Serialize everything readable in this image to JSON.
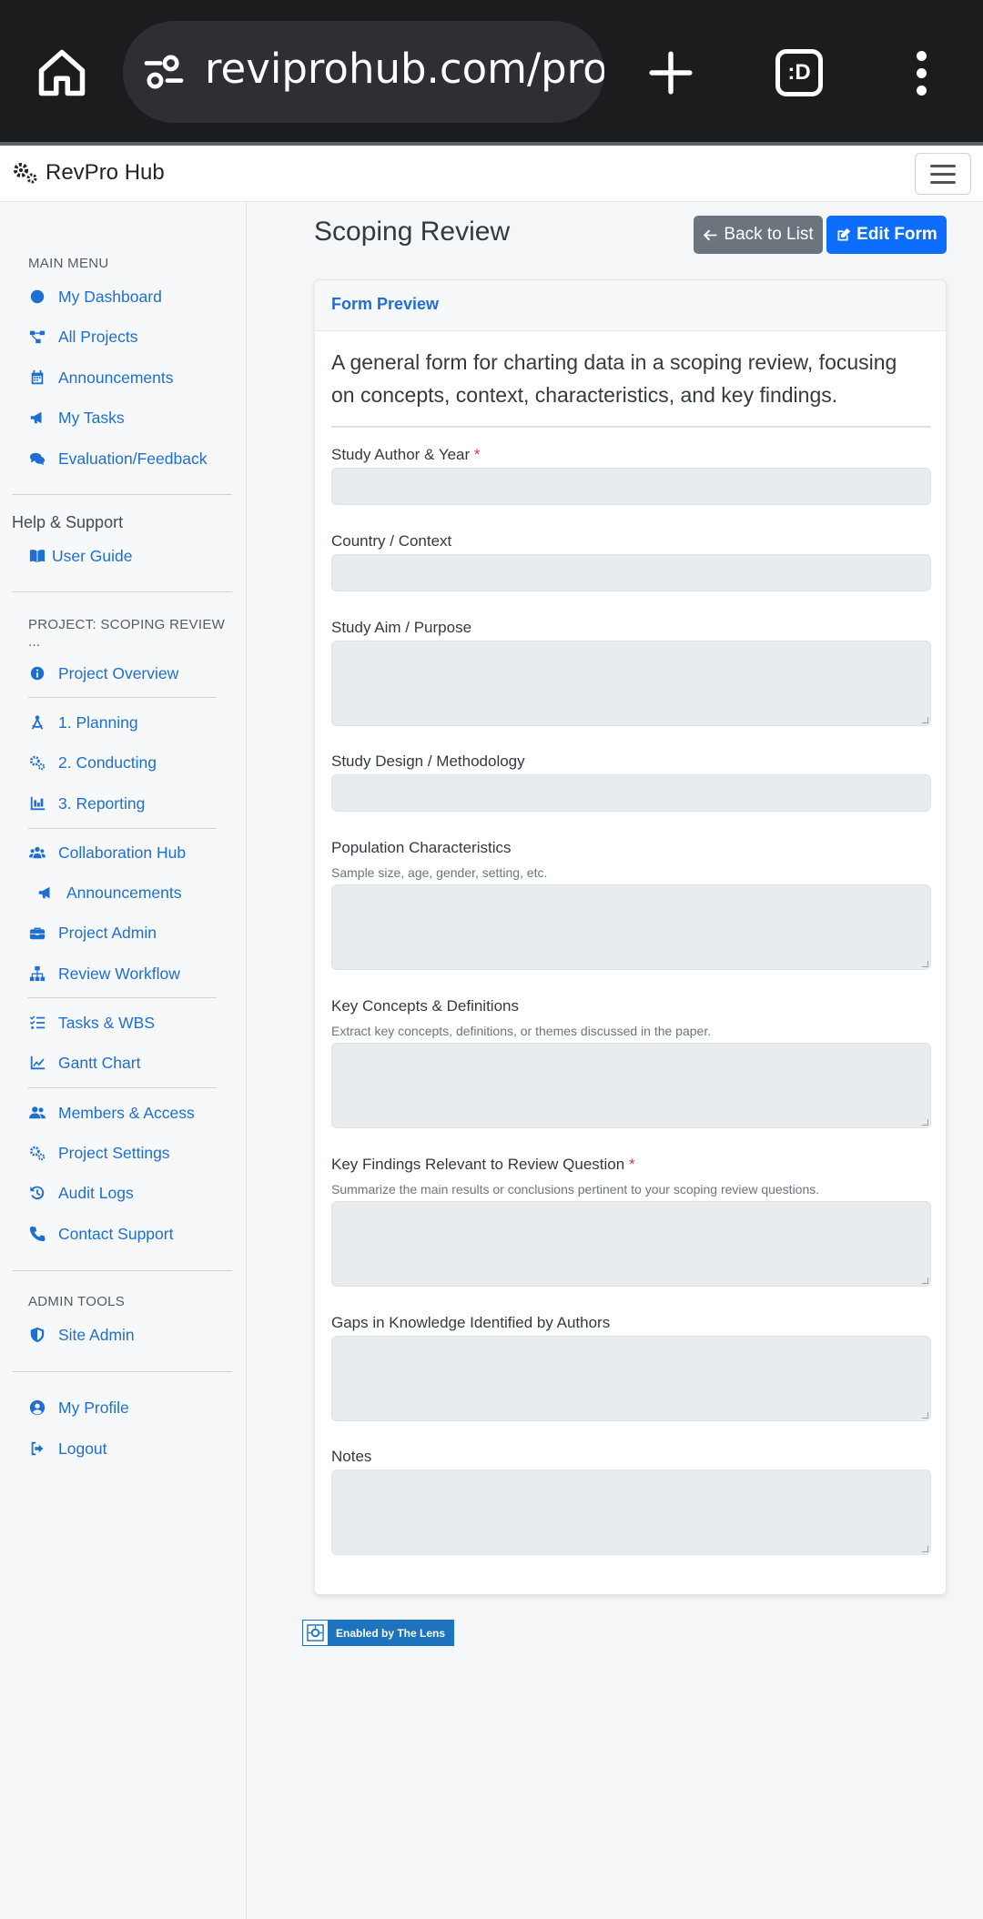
{
  "browser": {
    "url": "reviprohub.com/proje",
    "tabs_icon_label": ":D"
  },
  "navbar": {
    "brand": "RevPro Hub"
  },
  "sidebar": {
    "main_menu_heading": "MAIN MENU",
    "main_items": [
      {
        "label": "My Dashboard",
        "icon": "dashboard-icon"
      },
      {
        "label": "All Projects",
        "icon": "project-diagram-icon"
      },
      {
        "label": "Announcements",
        "icon": "calendar-icon"
      },
      {
        "label": "My Tasks",
        "icon": "megaphone-icon"
      },
      {
        "label": "Evaluation/Feedback",
        "icon": "comments-icon"
      }
    ],
    "help_heading": "Help & Support",
    "help_items": [
      {
        "label": "User Guide",
        "icon": "book-icon"
      }
    ],
    "project_heading": "PROJECT: SCOPING REVIEW ...",
    "project_items": [
      {
        "label": "Project Overview",
        "icon": "info-icon"
      },
      {
        "label": "1. Planning",
        "icon": "drafting-compass-icon"
      },
      {
        "label": "2. Conducting",
        "icon": "cogs-icon"
      },
      {
        "label": "3. Reporting",
        "icon": "bar-chart-icon"
      },
      {
        "label": "Collaboration Hub",
        "icon": "users-icon"
      },
      {
        "label": "Announcements",
        "icon": "megaphone-icon"
      },
      {
        "label": "Project Admin",
        "icon": "toolbox-icon"
      },
      {
        "label": "Review Workflow",
        "icon": "sitemap-icon"
      },
      {
        "label": "Tasks & WBS",
        "icon": "tasks-icon"
      },
      {
        "label": "Gantt Chart",
        "icon": "line-chart-icon"
      },
      {
        "label": "Members & Access",
        "icon": "user-group-icon"
      },
      {
        "label": "Project Settings",
        "icon": "cogs-icon"
      },
      {
        "label": "Audit Logs",
        "icon": "history-icon"
      },
      {
        "label": "Contact Support",
        "icon": "phone-icon"
      }
    ],
    "admin_heading": "ADMIN TOOLS",
    "admin_items": [
      {
        "label": "Site Admin",
        "icon": "shield-icon"
      }
    ],
    "account_items": [
      {
        "label": "My Profile",
        "icon": "user-circle-icon"
      },
      {
        "label": "Logout",
        "icon": "logout-icon"
      }
    ]
  },
  "main": {
    "title": "Scoping Review",
    "back_label": "Back to List",
    "edit_label": "Edit Form",
    "card_title": "Form Preview",
    "description": "A general form for charting data in a scoping review, focusing on concepts, context, characteristics, and key findings.",
    "fields": [
      {
        "label": "Study Author & Year",
        "required": "*",
        "help": ""
      },
      {
        "label": "Country / Context",
        "help": ""
      },
      {
        "label": "Study Aim / Purpose",
        "help": ""
      },
      {
        "label": "Study Design / Methodology",
        "help": ""
      },
      {
        "label": "Population Characteristics",
        "help": "Sample size, age, gender, setting, etc."
      },
      {
        "label": "Key Concepts & Definitions",
        "help": "Extract key concepts, definitions, or themes discussed in the paper."
      },
      {
        "label": "Key Findings Relevant to Review Question",
        "required": "*",
        "help": "Summarize the main results or conclusions pertinent to your scoping review questions."
      },
      {
        "label": "Gaps in Knowledge Identified by Authors",
        "help": ""
      },
      {
        "label": "Notes",
        "help": ""
      }
    ]
  },
  "footer": {
    "lens_badge": "Enabled by The Lens"
  }
}
